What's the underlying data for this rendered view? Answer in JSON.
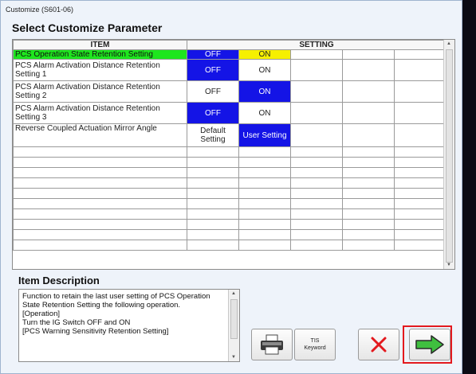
{
  "window": {
    "title": "Customize (S601-06)"
  },
  "heading": "Select Customize Parameter",
  "grid": {
    "headers": {
      "item": "ITEM",
      "setting": "SETTING"
    },
    "rows": [
      {
        "item": "PCS Operation State Retention Setting",
        "s1": "OFF",
        "s2": "ON"
      },
      {
        "item": "PCS Alarm Activation Distance Retention Setting 1",
        "s1": "OFF",
        "s2": "ON"
      },
      {
        "item": "PCS Alarm Activation Distance Retention Setting 2",
        "s1": "OFF",
        "s2": "ON"
      },
      {
        "item": "PCS Alarm Activation Distance Retention Setting 3",
        "s1": "OFF",
        "s2": "ON"
      },
      {
        "item": "Reverse Coupled Actuation Mirror Angle",
        "s1": "Default Setting",
        "s2": "User Setting"
      }
    ]
  },
  "description": {
    "title": "Item Description",
    "text": "Function to retain the last user setting of PCS Operation State Retention Setting the following operation.\n[Operation]\n Turn the IG Switch OFF and ON\n[PCS Warning Sensitivity Retention Setting]"
  },
  "buttons": {
    "tis_line1": "TIS",
    "tis_line2": "Keyword"
  },
  "icons": {
    "print": "printer-icon",
    "cancel": "cross-icon",
    "next": "green-arrow-icon"
  },
  "colors": {
    "selected_row": "#1ee61e",
    "selected_value": "#1414e6",
    "current_value": "#f6f000",
    "highlight": "#e3191e"
  }
}
